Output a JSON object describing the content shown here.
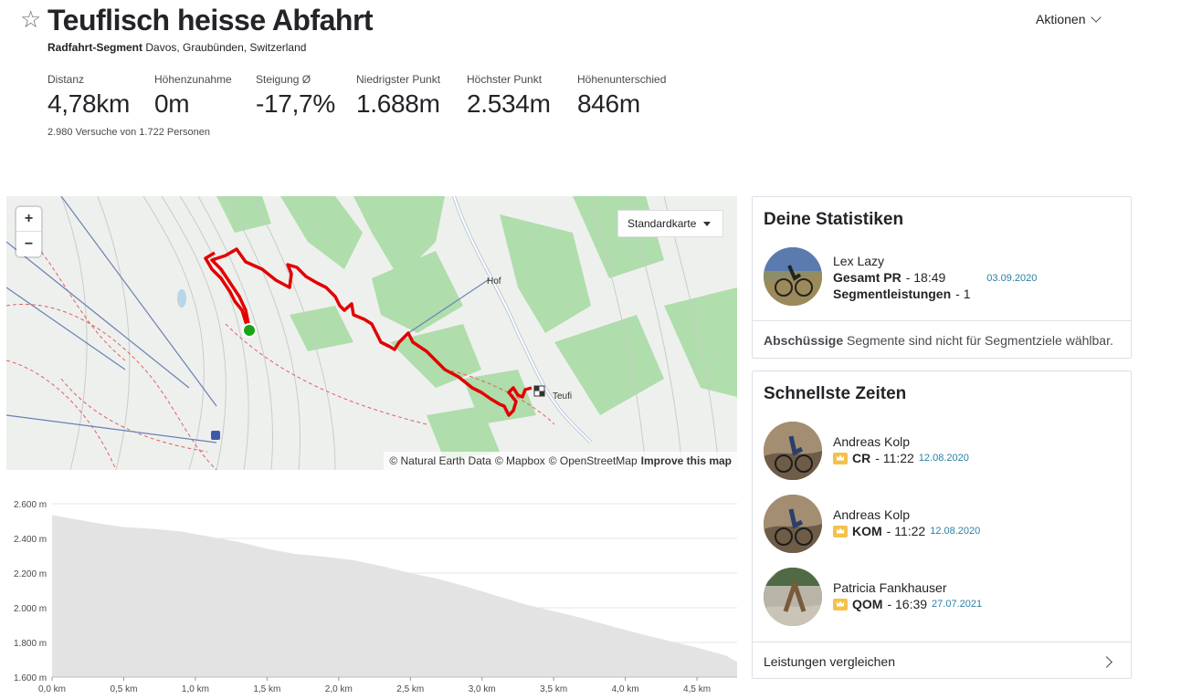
{
  "header": {
    "title": "Teuflisch heisse Abfahrt",
    "segment_type": "Radfahrt-Segment",
    "location": "Davos, Graubünden, Switzerland",
    "actions_label": "Aktionen"
  },
  "stats": [
    {
      "label": "Distanz",
      "value": "4,78km"
    },
    {
      "label": "Höhenzunahme",
      "value": "0m"
    },
    {
      "label": "Steigung Ø",
      "value": "-17,7%"
    },
    {
      "label": "Niedrigster Punkt",
      "value": "1.688m"
    },
    {
      "label": "Höchster Punkt",
      "value": "2.534m"
    },
    {
      "label": "Höhenunterschied",
      "value": "846m"
    }
  ],
  "attempts": "2.980 Versuche von 1.722 Personen",
  "map": {
    "zoom_in": "+",
    "zoom_out": "−",
    "type_selector": "Standardkarte",
    "labels": {
      "hof": "Hof",
      "teufi": "Teufi"
    },
    "attribution": {
      "natural_earth": "© Natural Earth Data",
      "mapbox": "© Mapbox",
      "osm": "© OpenStreetMap",
      "improve": "Improve this map"
    },
    "colors": {
      "route": "#e30000",
      "start": "#1aa31a",
      "forest": "#9ed79a"
    }
  },
  "chart_data": {
    "type": "area",
    "xlabel": "",
    "ylabel": "",
    "x_ticks": [
      "0,0 km",
      "0,5 km",
      "1,0 km",
      "1,5 km",
      "2,0 km",
      "2,5 km",
      "3,0 km",
      "3,5 km",
      "4,0 km",
      "4,5 km"
    ],
    "y_ticks": [
      "2.600 m",
      "2.400 m",
      "2.200 m",
      "2.000 m",
      "1.800 m",
      "1.600 m"
    ],
    "xlim": [
      0,
      4.78
    ],
    "ylim": [
      1600,
      2600
    ],
    "series": [
      {
        "x": [
          0,
          0.1,
          0.3,
          0.5,
          0.7,
          0.9,
          1.1,
          1.3,
          1.5,
          1.7,
          1.9,
          2.1,
          2.3,
          2.5,
          2.7,
          2.9,
          3.1,
          3.3,
          3.5,
          3.7,
          3.9,
          4.1,
          4.3,
          4.5,
          4.7,
          4.78
        ],
        "y": [
          2534,
          2520,
          2490,
          2465,
          2455,
          2440,
          2410,
          2380,
          2340,
          2310,
          2295,
          2275,
          2240,
          2200,
          2165,
          2120,
          2070,
          2020,
          1980,
          1940,
          1895,
          1850,
          1810,
          1770,
          1725,
          1688
        ]
      }
    ],
    "fill_color": "#e3e3e3",
    "grid": true
  },
  "my_stats": {
    "title": "Deine Statistiken",
    "name": "Lex Lazy",
    "pr_label": "Gesamt PR",
    "pr_value": "- 18:49",
    "pr_date": "03.09.2020",
    "efforts_label": "Segmentleistungen",
    "efforts_value": "- 1",
    "note_bold": "Abschüssige",
    "note_text": "Segmente sind nicht für Segmentziele wählbar."
  },
  "fastest": {
    "title": "Schnellste Zeiten",
    "entries": [
      {
        "name": "Andreas Kolp",
        "badge": "CR",
        "time": "- 11:22",
        "date": "12.08.2020"
      },
      {
        "name": "Andreas Kolp",
        "badge": "KOM",
        "time": "- 11:22",
        "date": "12.08.2020"
      },
      {
        "name": "Patricia Fankhauser",
        "badge": "QOM",
        "time": "- 16:39",
        "date": "27.07.2021"
      }
    ],
    "compare_label": "Leistungen vergleichen"
  }
}
